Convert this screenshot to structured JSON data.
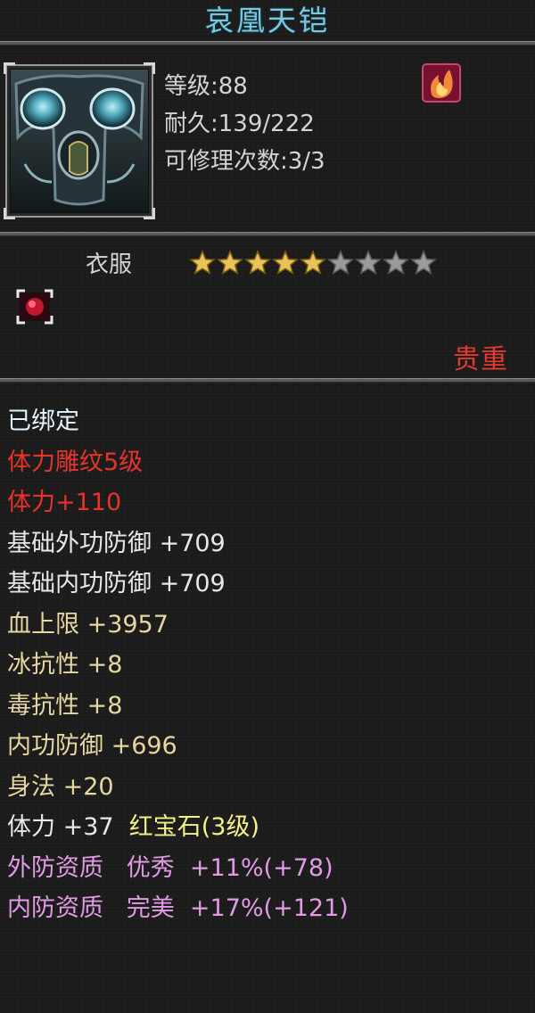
{
  "item": {
    "name": "哀凰天铠",
    "level_text": "等级:88",
    "durability_text": "耐久:139/222",
    "repair_text": "可修理次数:3/3",
    "type": "衣服",
    "stars_filled": 5,
    "stars_total": 9,
    "rarity": "贵重"
  },
  "attributes": [
    {
      "text": "已绑定",
      "color": "white"
    },
    {
      "text": "体力雕纹5级",
      "color": "red"
    },
    {
      "text": "体力+110",
      "color": "red"
    },
    {
      "text": "基础外功防御  +709",
      "color": "base"
    },
    {
      "text": "基础内功防御  +709",
      "color": "base"
    },
    {
      "text": "血上限  +3957",
      "color": "gold"
    },
    {
      "text": "冰抗性  +8",
      "color": "gold"
    },
    {
      "text": "毒抗性  +8",
      "color": "gold"
    },
    {
      "text": "内功防御  +696",
      "color": "gold"
    },
    {
      "text": "身法  +20",
      "color": "gold"
    }
  ],
  "gem_line": {
    "stat": "体力  +37",
    "gem": "红宝石(3级)"
  },
  "quality_lines": [
    {
      "label": "外防资质",
      "grade": "优秀",
      "value": "+11%(+78)"
    },
    {
      "label": "内防资质",
      "grade": "完美",
      "value": "+17%(+121)"
    }
  ],
  "colors": {
    "title": "#7cc7dc",
    "rarity": "#e23a2c",
    "star_gold": "#e8c35a",
    "star_empty": "#9a9a9a",
    "quality": "#e19be5"
  },
  "icons": [
    "armor-portrait",
    "flame-badge-icon",
    "red-gem-slot-icon",
    "star-icon"
  ]
}
